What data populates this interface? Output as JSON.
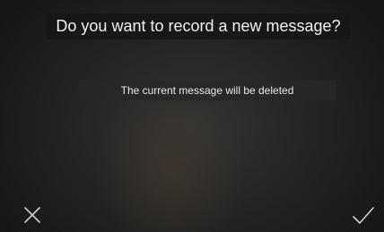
{
  "dialog": {
    "title": "Do you want to record a new message?",
    "subtitle": "The current message will be deleted"
  },
  "actions": {
    "cancel_icon": "close-icon",
    "confirm_icon": "checkmark-icon"
  },
  "colors": {
    "text": "#f2f2f2",
    "icon": "#cfcfcf",
    "background": "#262626"
  }
}
